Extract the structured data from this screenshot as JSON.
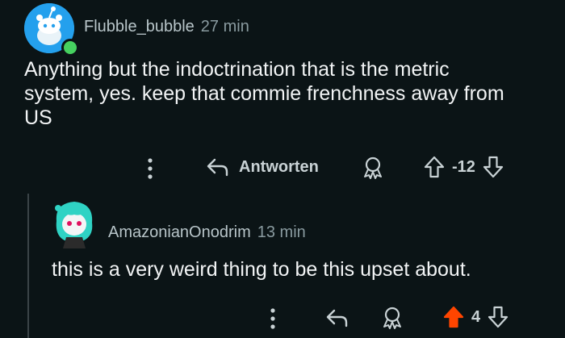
{
  "comments": [
    {
      "username": "Flubble_bubble",
      "time": "27 min",
      "text": "Anything but the indoctrination that is the metric system, yes. keep that commie frenchness away from US",
      "reply_label": "Antworten",
      "score": "-12"
    },
    {
      "username": "AmazonianOnodrim",
      "time": "13 min",
      "text": "this is a very weird thing to be this upset about.",
      "score": "4",
      "upvoted": true
    }
  ],
  "colors": {
    "background": "#0b1416",
    "upvote_active": "#ff4500",
    "online_dot": "#46d160",
    "avatar1_bg": "#24a0ed"
  },
  "icons": [
    "more-icon",
    "reply-icon",
    "award-icon",
    "upvote-icon",
    "downvote-icon"
  ]
}
